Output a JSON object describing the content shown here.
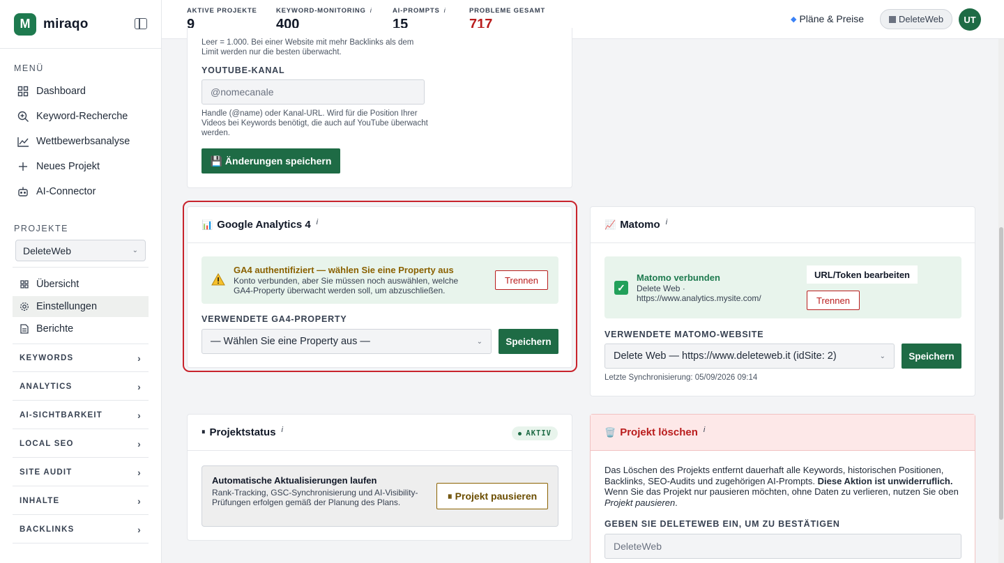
{
  "brand": {
    "name": "miraqo",
    "mark": "M"
  },
  "sidebar": {
    "menu_label": "MENÜ",
    "menu": [
      {
        "label": "Dashboard",
        "icon": "grid-icon"
      },
      {
        "label": "Keyword-Recherche",
        "icon": "search-plus-icon"
      },
      {
        "label": "Wettbewerbsanalyse",
        "icon": "chart-line-icon"
      },
      {
        "label": "Neues Projekt",
        "icon": "plus-icon"
      },
      {
        "label": "AI-Connector",
        "icon": "robot-icon"
      }
    ],
    "projects_label": "PROJEKTE",
    "project_selected": "DeleteWeb",
    "project_nav": [
      {
        "label": "Übersicht",
        "icon": "grid-icon"
      },
      {
        "label": "Einstellungen",
        "icon": "gear-icon"
      },
      {
        "label": "Berichte",
        "icon": "document-icon"
      }
    ],
    "groups": [
      "KEYWORDS",
      "ANALYTICS",
      "AI-SICHTBARKEIT",
      "LOCAL SEO",
      "SITE AUDIT",
      "INHALTE",
      "BACKLINKS"
    ]
  },
  "topbar": {
    "stats": [
      {
        "label": "AKTIVE PROJEKTE",
        "value": "9",
        "info": ""
      },
      {
        "label": "KEYWORD-MONITORING",
        "value": "400",
        "info": "i"
      },
      {
        "label": "AI-PROMPTS",
        "value": "15",
        "info": "i"
      },
      {
        "label": "PROBLEME GESAMT",
        "value": "717",
        "info": ""
      }
    ],
    "plans_label": "Pläne & Preise",
    "workspace": "DeleteWeb",
    "avatar": "UT"
  },
  "top_card": {
    "backlink_help": "Leer = 1.000. Bei einer Website mit mehr Backlinks als dem Limit werden nur die besten überwacht.",
    "youtube_label": "YOUTUBE-KANAL",
    "youtube_placeholder": "@nomecanale",
    "youtube_help": "Handle (@name) oder Kanal-URL. Wird für die Position Ihrer Videos bei Keywords benötigt, die auch auf YouTube überwacht werden.",
    "save_button": "💾 Änderungen speichern"
  },
  "ga4": {
    "title": "Google Analytics 4",
    "icon": "📊",
    "info": "i",
    "notice_title": "GA4 authentifiziert — wählen Sie eine Property aus",
    "notice_text": "Konto verbunden, aber Sie müssen noch auswählen, welche GA4-Property überwacht werden soll, um abzuschließen.",
    "disconnect": "Trennen",
    "field_label": "VERWENDETE GA4-PROPERTY",
    "select_value": "— Wählen Sie eine Property aus —",
    "save": "Speichern"
  },
  "matomo": {
    "title": "Matomo",
    "icon": "📈",
    "info": "i",
    "notice_title": "Matomo verbunden",
    "notice_line1": "Delete Web ·",
    "notice_line2": "https://www.analytics.mysite.com/",
    "edit": "URL/Token bearbeiten",
    "disconnect": "Trennen",
    "field_label": "VERWENDETE MATOMO-WEBSITE",
    "select_value": "Delete Web — https://www.deleteweb.it (idSite: 2)",
    "save": "Speichern",
    "sync": "Letzte Synchronisierung: 05/09/2026 09:14"
  },
  "status": {
    "title": "Projektstatus",
    "info": "i",
    "badge": "AKTIV",
    "notice_title": "Automatische Aktualisierungen laufen",
    "notice_text": "Rank-Tracking, GSC-Synchronisierung und AI-Visibility-Prüfungen erfolgen gemäß der Planung des Plans.",
    "pause": "⏸ Projekt pausieren"
  },
  "delete": {
    "title": "Projekt löschen",
    "icon": "🗑️",
    "info": "i",
    "text_a": "Das Löschen des Projekts entfernt dauerhaft alle Keywords, historischen Positionen, Backlinks, SEO-Audits und zugehörigen AI-Prompts. ",
    "text_bold": "Diese Aktion ist unwiderruflich.",
    "text_b": " Wenn Sie das Projekt nur pausieren möchten, ohne Daten zu verlieren, nutzen Sie oben ",
    "text_italic": "Projekt pausieren",
    "text_c": ".",
    "confirm_label": "GEBEN SIE DELETEWEB EIN, UM ZU BESTÄTIGEN",
    "confirm_placeholder": "DeleteWeb"
  },
  "colors": {
    "accent": "#1e6b45",
    "danger": "#b91c1c",
    "highlight": "#c8232c"
  }
}
